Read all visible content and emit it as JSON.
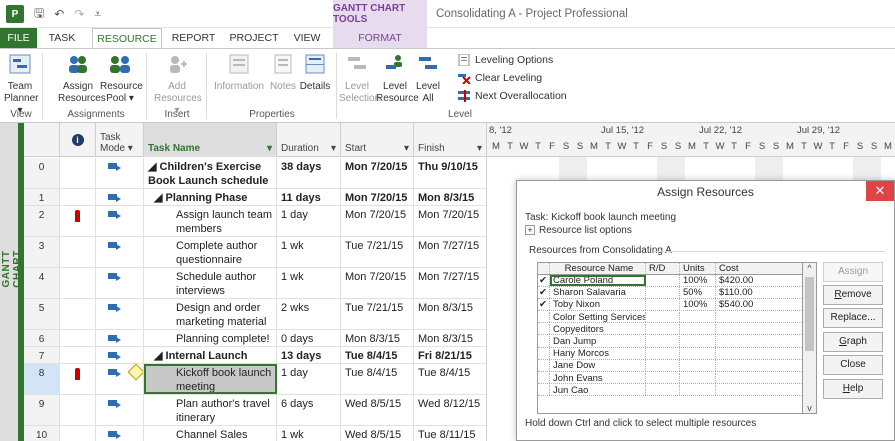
{
  "titlebar": {
    "app_icon": "P",
    "qat_icons": [
      "save-icon",
      "undo-icon",
      "redo-icon",
      "customize-icon"
    ],
    "context_group": "GANTT CHART TOOLS",
    "document_title": "Consolidating A - Project Professional"
  },
  "tabs": [
    "FILE",
    "TASK",
    "RESOURCE",
    "REPORT",
    "PROJECT",
    "VIEW",
    "FORMAT"
  ],
  "active_tab": "RESOURCE",
  "ribbon": {
    "team_planner": [
      "Team",
      "Planner ▾"
    ],
    "assign_resources": [
      "Assign",
      "Resources"
    ],
    "resource_pool": [
      "Resource",
      "Pool ▾"
    ],
    "add_resources": [
      "Add",
      "Resources ▾"
    ],
    "information": "Information",
    "notes": "Notes",
    "details": "Details",
    "level_selection": [
      "Level",
      "Selection"
    ],
    "level_resource": [
      "Level",
      "Resource"
    ],
    "level_all": [
      "Level",
      "All"
    ],
    "leveling_options": "Leveling Options",
    "clear_leveling": "Clear Leveling",
    "next_overallocation": "Next Overallocation",
    "groups": [
      "View",
      "Assignments",
      "Insert",
      "Properties",
      "Level"
    ]
  },
  "sidebar_label": "GANTT CHART",
  "grid": {
    "headers": {
      "mode": "Task Mode ▾",
      "name": "Task Name",
      "duration": "Duration",
      "start": "Start",
      "finish": "Finish"
    },
    "rows": [
      {
        "id": "0",
        "name": "◢ Children's Exercise Book Launch schedule",
        "duration": "38 days",
        "start": "Mon 7/20/15",
        "finish": "Thu 9/10/15",
        "bold": true,
        "indent": 0,
        "lines": 2,
        "ind": false,
        "sel": false
      },
      {
        "id": "1",
        "name": "◢ Planning Phase",
        "duration": "11 days",
        "start": "Mon 7/20/15",
        "finish": "Mon 8/3/15",
        "bold": true,
        "indent": 1,
        "lines": 1,
        "ind": false,
        "sel": false
      },
      {
        "id": "2",
        "name": "Assign launch team members",
        "duration": "1 day",
        "start": "Mon 7/20/15",
        "finish": "Mon 7/20/15",
        "bold": false,
        "indent": 2,
        "lines": 2,
        "ind": true,
        "sel": false
      },
      {
        "id": "3",
        "name": "Complete author questionnaire",
        "duration": "1 wk",
        "start": "Tue 7/21/15",
        "finish": "Mon 7/27/15",
        "bold": false,
        "indent": 2,
        "lines": 2,
        "ind": false,
        "sel": false
      },
      {
        "id": "4",
        "name": "Schedule author interviews",
        "duration": "1 wk",
        "start": "Mon 7/20/15",
        "finish": "Mon 7/27/15",
        "bold": false,
        "indent": 2,
        "lines": 2,
        "ind": false,
        "sel": false
      },
      {
        "id": "5",
        "name": "Design and order marketing material",
        "duration": "2 wks",
        "start": "Tue 7/21/15",
        "finish": "Mon 8/3/15",
        "bold": false,
        "indent": 2,
        "lines": 2,
        "ind": false,
        "sel": false
      },
      {
        "id": "6",
        "name": "Planning complete!",
        "duration": "0 days",
        "start": "Mon 8/3/15",
        "finish": "Mon 8/3/15",
        "bold": false,
        "indent": 2,
        "lines": 1,
        "ind": false,
        "sel": false
      },
      {
        "id": "7",
        "name": "◢ Internal Launch Phase",
        "duration": "13 days",
        "start": "Tue 8/4/15",
        "finish": "Fri 8/21/15",
        "bold": true,
        "indent": 1,
        "lines": 1,
        "ind": false,
        "sel": false
      },
      {
        "id": "8",
        "name": "Kickoff book launch meeting",
        "duration": "1 day",
        "start": "Tue 8/4/15",
        "finish": "Tue 8/4/15",
        "bold": false,
        "indent": 2,
        "lines": 2,
        "ind": true,
        "sel": true
      },
      {
        "id": "9",
        "name": "Plan author's travel itinerary",
        "duration": "6 days",
        "start": "Wed 8/5/15",
        "finish": "Wed 8/12/15",
        "bold": false,
        "indent": 2,
        "lines": 2,
        "ind": false,
        "sel": false
      },
      {
        "id": "10",
        "name": "Channel Sales prep",
        "duration": "1 wk",
        "start": "Wed 8/5/15",
        "finish": "Tue 8/11/15",
        "bold": false,
        "indent": 2,
        "lines": 1,
        "ind": false,
        "sel": false
      }
    ]
  },
  "gantt": {
    "weeks": [
      "8, '12",
      "Jul 15, '12",
      "Jul 22, '12",
      "Jul 29, '12"
    ],
    "days": [
      "M",
      "T",
      "W",
      "T",
      "F",
      "S",
      "S",
      "M",
      "T",
      "W",
      "T",
      "F",
      "S",
      "S",
      "M",
      "T",
      "W",
      "T",
      "F",
      "S",
      "S",
      "M",
      "T",
      "W",
      "T",
      "F",
      "S",
      "S",
      "M",
      "T"
    ]
  },
  "dialog": {
    "title": "Assign Resources",
    "task_label": "Task: Kickoff book launch meeting",
    "options_label": "Resource list options",
    "resources_from": "Resources from Consolidating A",
    "columns": [
      "Resource Name",
      "R/D",
      "Units",
      "Cost"
    ],
    "resources": [
      {
        "check": "✔",
        "name": "Carole Poland",
        "rd": "",
        "units": "100%",
        "cost": "$420.00"
      },
      {
        "check": "✔",
        "name": "Sharon Salavaria",
        "rd": "",
        "units": "50%",
        "cost": "$110.00"
      },
      {
        "check": "✔",
        "name": "Toby Nixon",
        "rd": "",
        "units": "100%",
        "cost": "$540.00"
      },
      {
        "check": "",
        "name": "Color Setting Services",
        "rd": "",
        "units": "",
        "cost": ""
      },
      {
        "check": "",
        "name": "Copyeditors",
        "rd": "",
        "units": "",
        "cost": ""
      },
      {
        "check": "",
        "name": "Dan Jump",
        "rd": "",
        "units": "",
        "cost": ""
      },
      {
        "check": "",
        "name": "Hany Morcos",
        "rd": "",
        "units": "",
        "cost": ""
      },
      {
        "check": "",
        "name": "Jane Dow",
        "rd": "",
        "units": "",
        "cost": ""
      },
      {
        "check": "",
        "name": "John Evans",
        "rd": "",
        "units": "",
        "cost": ""
      },
      {
        "check": "",
        "name": "Jun Cao",
        "rd": "",
        "units": "",
        "cost": ""
      }
    ],
    "buttons": {
      "assign": "Assign",
      "remove": "Remove",
      "replace": "Replace...",
      "graph": "Graph",
      "close": "Close",
      "help": "Help"
    },
    "footer": "Hold down Ctrl and click to select multiple resources"
  }
}
